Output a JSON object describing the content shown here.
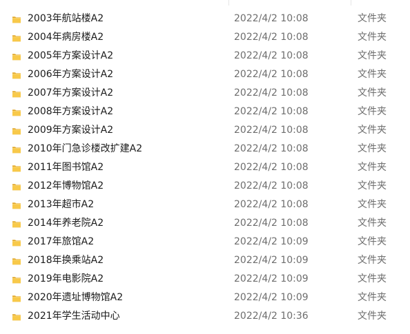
{
  "file_list": {
    "rows": [
      {
        "name": "2003年航站楼A2",
        "modified": "2022/4/2 10:08",
        "type": "文件夹",
        "icon": "folder-icon"
      },
      {
        "name": "2004年病房楼A2",
        "modified": "2022/4/2 10:08",
        "type": "文件夹",
        "icon": "folder-icon"
      },
      {
        "name": "2005年方案设计A2",
        "modified": "2022/4/2 10:08",
        "type": "文件夹",
        "icon": "folder-icon"
      },
      {
        "name": "2006年方案设计A2",
        "modified": "2022/4/2 10:08",
        "type": "文件夹",
        "icon": "folder-icon"
      },
      {
        "name": "2007年方案设计A2",
        "modified": "2022/4/2 10:08",
        "type": "文件夹",
        "icon": "folder-icon"
      },
      {
        "name": "2008年方案设计A2",
        "modified": "2022/4/2 10:08",
        "type": "文件夹",
        "icon": "folder-icon"
      },
      {
        "name": "2009年方案设计A2",
        "modified": "2022/4/2 10:08",
        "type": "文件夹",
        "icon": "folder-icon"
      },
      {
        "name": "2010年门急诊楼改扩建A2",
        "modified": "2022/4/2 10:08",
        "type": "文件夹",
        "icon": "folder-icon"
      },
      {
        "name": "2011年图书馆A2",
        "modified": "2022/4/2 10:08",
        "type": "文件夹",
        "icon": "folder-icon"
      },
      {
        "name": "2012年博物馆A2",
        "modified": "2022/4/2 10:08",
        "type": "文件夹",
        "icon": "folder-icon"
      },
      {
        "name": "2013年超市A2",
        "modified": "2022/4/2 10:08",
        "type": "文件夹",
        "icon": "folder-icon"
      },
      {
        "name": "2014年养老院A2",
        "modified": "2022/4/2 10:08",
        "type": "文件夹",
        "icon": "folder-icon"
      },
      {
        "name": "2017年旅馆A2",
        "modified": "2022/4/2 10:09",
        "type": "文件夹",
        "icon": "folder-icon"
      },
      {
        "name": "2018年换乘站A2",
        "modified": "2022/4/2 10:09",
        "type": "文件夹",
        "icon": "folder-icon"
      },
      {
        "name": "2019年电影院A2",
        "modified": "2022/4/2 10:09",
        "type": "文件夹",
        "icon": "folder-icon"
      },
      {
        "name": "2020年遗址博物馆A2",
        "modified": "2022/4/2 10:09",
        "type": "文件夹",
        "icon": "folder-icon"
      },
      {
        "name": "2021年学生活动中心",
        "modified": "2022/4/2 10:36",
        "type": "文件夹",
        "icon": "folder-icon"
      }
    ]
  },
  "colors": {
    "folder_body": "#f8c94a",
    "folder_tab": "#e2a92b",
    "name_text": "#1a1a1a",
    "meta_text": "#6d6d6d"
  }
}
